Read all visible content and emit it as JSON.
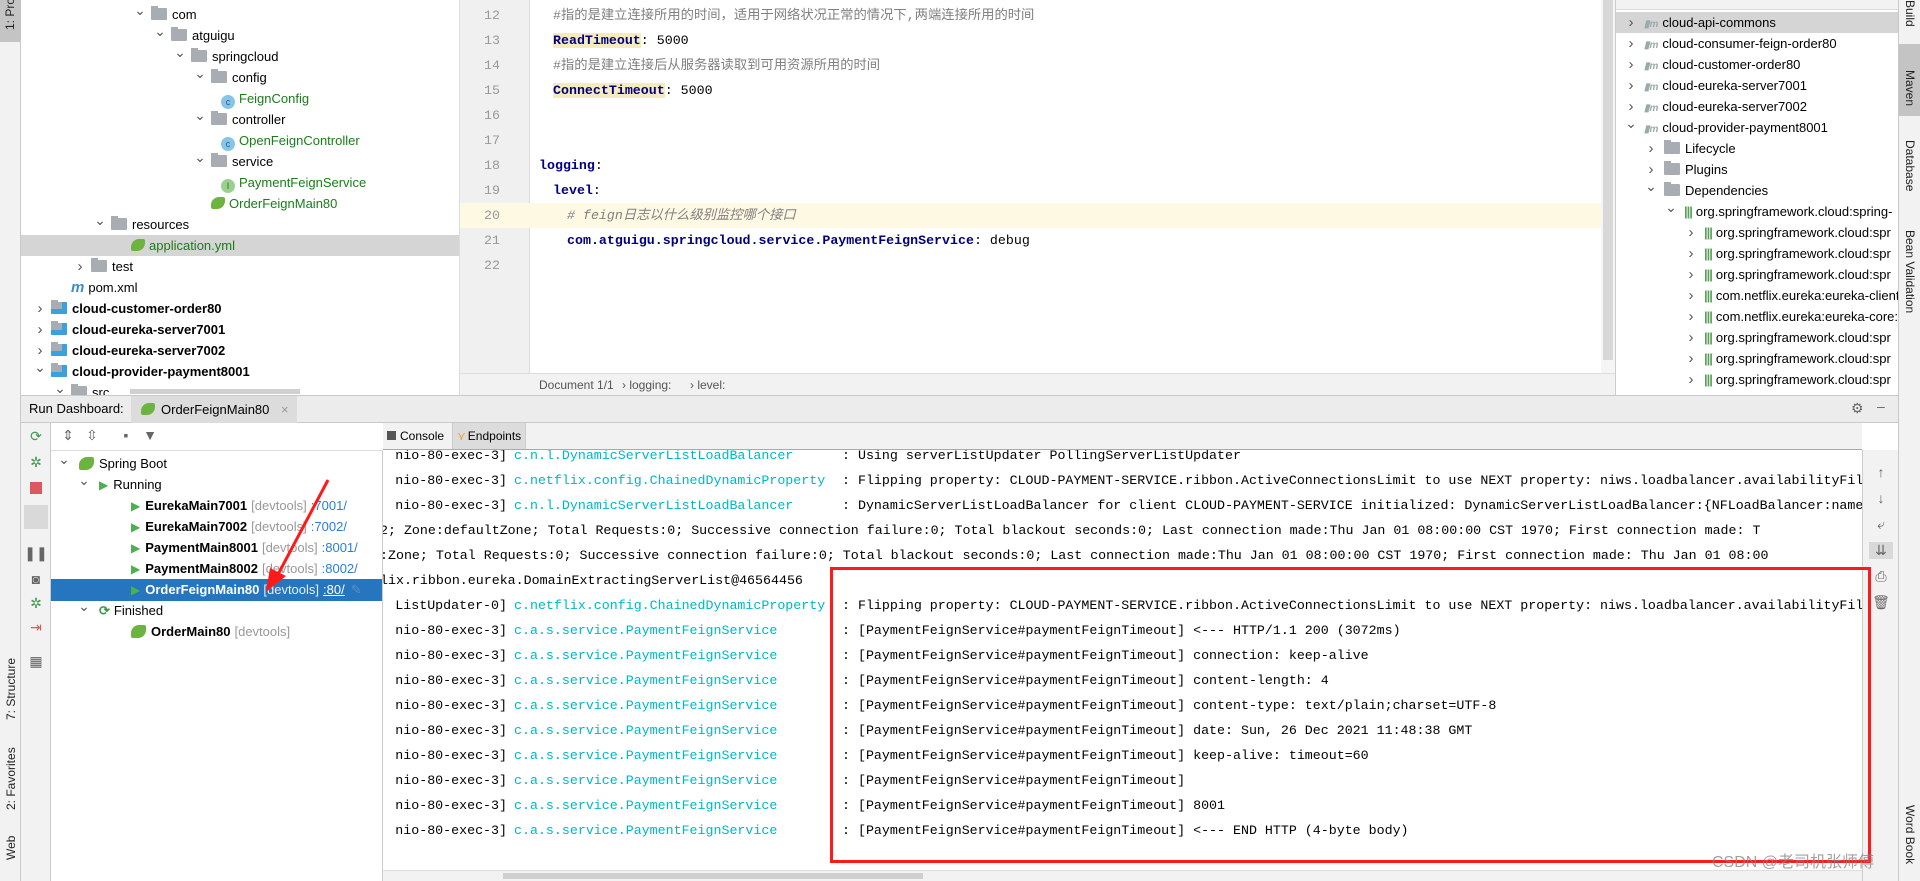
{
  "left_strip": {
    "project": "1: Project",
    "structure": "7: Structure",
    "favorites": "2: Favorites",
    "web": "Web"
  },
  "right_strip": {
    "build": "Build",
    "maven": "Maven",
    "database": "Database",
    "bean": "Bean Validation",
    "wordbook": "Word Book"
  },
  "project_tree": [
    {
      "label": "com",
      "type": "folder",
      "level": 5,
      "open": true
    },
    {
      "label": "atguigu",
      "type": "folder",
      "level": 6,
      "open": true
    },
    {
      "label": "springcloud",
      "type": "folder",
      "level": 7,
      "open": true
    },
    {
      "label": "config",
      "type": "folder",
      "level": 8,
      "open": true
    },
    {
      "label": "FeignConfig",
      "type": "class",
      "level": 9
    },
    {
      "label": "controller",
      "type": "folder",
      "level": 8,
      "open": true
    },
    {
      "label": "OpenFeignController",
      "type": "class",
      "level": 9
    },
    {
      "label": "service",
      "type": "folder",
      "level": 8,
      "open": true
    },
    {
      "label": "PaymentFeignService",
      "type": "interface",
      "level": 9
    },
    {
      "label": "OrderFeignMain80",
      "type": "boot",
      "level": 8
    },
    {
      "label": "resources",
      "type": "folder",
      "level": 3,
      "open": true
    },
    {
      "label": "application.yml",
      "type": "yml",
      "level": 4,
      "selected": true
    },
    {
      "label": "test",
      "type": "folder",
      "level": 2,
      "open": false
    },
    {
      "label": "pom.xml",
      "type": "pom",
      "level": 1
    },
    {
      "label": "cloud-customer-order80",
      "type": "module",
      "level": 0,
      "open": false
    },
    {
      "label": "cloud-eureka-server7001",
      "type": "module",
      "level": 0,
      "open": false
    },
    {
      "label": "cloud-eureka-server7002",
      "type": "module",
      "level": 0,
      "open": false
    },
    {
      "label": "cloud-provider-payment8001",
      "type": "module",
      "level": 0,
      "open": true
    },
    {
      "label": "src",
      "type": "folder",
      "level": 1,
      "open": true
    }
  ],
  "editor": {
    "lines": [
      {
        "n": "12",
        "indent": 1,
        "comment": "#指的是建立连接所用的时间，适用于网络状况正常的情况下,两端连接所用的时间"
      },
      {
        "n": "13",
        "indent": 1,
        "key": "ReadTimeout",
        "value": ": 5000",
        "hl": true
      },
      {
        "n": "14",
        "indent": 1,
        "comment": "#指的是建立连接后从服务器读取到可用资源所用的时间"
      },
      {
        "n": "15",
        "indent": 1,
        "key": "ConnectTimeout",
        "value": ": 5000",
        "hl": true
      },
      {
        "n": "16"
      },
      {
        "n": "17"
      },
      {
        "n": "18",
        "indent": 0,
        "key": "logging",
        "value": ":"
      },
      {
        "n": "19",
        "indent": 1,
        "key": "level",
        "value": ":"
      },
      {
        "n": "20",
        "indent": 2,
        "comment": "# feign日志以什么级别监控哪个接口",
        "current": true
      },
      {
        "n": "21",
        "indent": 2,
        "key": "com.atguigu.springcloud.service.PaymentFeignService",
        "value": ": debug"
      },
      {
        "n": "22"
      }
    ],
    "breadcrumb": [
      "Document 1/1",
      "logging:",
      "level:"
    ]
  },
  "maven": {
    "items": [
      {
        "label": "cloud-api-commons",
        "level": 0,
        "selected": true
      },
      {
        "label": "cloud-consumer-feign-order80",
        "level": 0
      },
      {
        "label": "cloud-customer-order80",
        "level": 0
      },
      {
        "label": "cloud-eureka-server7001",
        "level": 0
      },
      {
        "label": "cloud-eureka-server7002",
        "level": 0
      },
      {
        "label": "cloud-provider-payment8001",
        "level": 0,
        "open": true
      },
      {
        "label": "Lifecycle",
        "level": 1
      },
      {
        "label": "Plugins",
        "level": 1
      },
      {
        "label": "Dependencies",
        "level": 1,
        "open": true
      },
      {
        "label": "org.springframework.cloud:spring-",
        "level": 2,
        "open": true
      },
      {
        "label": "org.springframework.cloud:spr",
        "level": 3
      },
      {
        "label": "org.springframework.cloud:spr",
        "level": 3
      },
      {
        "label": "org.springframework.cloud:spr",
        "level": 3
      },
      {
        "label": "com.netflix.eureka:eureka-client",
        "level": 3
      },
      {
        "label": "com.netflix.eureka:eureka-core:",
        "level": 3
      },
      {
        "label": "org.springframework.cloud:spr",
        "level": 3
      },
      {
        "label": "org.springframework.cloud:spr",
        "level": 3
      },
      {
        "label": "org.springframework.cloud:spr",
        "level": 3
      }
    ]
  },
  "run_dashboard": {
    "title": "Run Dashboard:",
    "tab": "OrderFeignMain80",
    "tree": [
      {
        "label": "Spring Boot",
        "level": 0,
        "type": "group"
      },
      {
        "label": "Running",
        "level": 1,
        "type": "running"
      },
      {
        "label": "EurekaMain7001",
        "tag": "[devtools]",
        "port": ":7001/",
        "level": 2,
        "type": "app"
      },
      {
        "label": "EurekaMain7002",
        "tag": "[devtools]",
        "port": ":7002/",
        "level": 2,
        "type": "app"
      },
      {
        "label": "PaymentMain8001",
        "tag": "[devtools]",
        "port": ":8001/",
        "level": 2,
        "type": "app"
      },
      {
        "label": "PaymentMain8002",
        "tag": "[devtools]",
        "port": ":8002/",
        "level": 2,
        "type": "app"
      },
      {
        "label": "OrderFeignMain80",
        "tag": "[devtools]",
        "port": ":80/",
        "level": 2,
        "type": "app",
        "selected": true
      },
      {
        "label": "Finished",
        "level": 1,
        "type": "finished"
      },
      {
        "label": "OrderMain80",
        "tag": "[devtools]",
        "level": 2,
        "type": "finishedapp"
      }
    ],
    "console_tabs": [
      "Console",
      "Endpoints"
    ],
    "console_lines": [
      {
        "thread": "nio-80-exec-3]",
        "logger": "c.n.l.DynamicServerListLoadBalancer",
        "msg": ": Using serverListUpdater PollingServerListUpdater"
      },
      {
        "thread": "nio-80-exec-3]",
        "logger": "c.netflix.config.ChainedDynamicProperty",
        "msg": ": Flipping property: CLOUD-PAYMENT-SERVICE.ribbon.ActiveConnectionsLimit to use NEXT property: niws.loadbalancer.availabilityFil"
      },
      {
        "thread": "nio-80-exec-3]",
        "logger": "c.n.l.DynamicServerListLoadBalancer",
        "msg": ": DynamicServerListLoadBalancer for client CLOUD-PAYMENT-SERVICE initialized: DynamicServerListLoadBalancer:{NFLoadBalancer:name="
      },
      {
        "plain": "2;   Zone:defaultZone;   Total Requests:0;   Successive connection failure:0;   Total blackout seconds:0;   Last connection made:Thu Jan 01 08:00:00 CST 1970;   First connection made: T"
      },
      {
        "plain": ":Zone;   Total Requests:0;   Successive connection failure:0;   Total blackout seconds:0;   Last connection made:Thu Jan 01 08:00:00 CST 1970;   First connection made: Thu Jan 01 08:00"
      },
      {
        "plain": "lix.ribbon.eureka.DomainExtractingServerList@46564456"
      },
      {
        "thread": "ListUpdater-0]",
        "logger": "c.netflix.config.ChainedDynamicProperty",
        "msg": ": Flipping property: CLOUD-PAYMENT-SERVICE.ribbon.ActiveConnectionsLimit to use NEXT property: niws.loadbalancer.availabilityFil"
      },
      {
        "thread": "nio-80-exec-3]",
        "logger": "c.a.s.service.PaymentFeignService",
        "msg": ": [PaymentFeignService#paymentFeignTimeout] <--- HTTP/1.1 200 (3072ms)"
      },
      {
        "thread": "nio-80-exec-3]",
        "logger": "c.a.s.service.PaymentFeignService",
        "msg": ": [PaymentFeignService#paymentFeignTimeout] connection: keep-alive"
      },
      {
        "thread": "nio-80-exec-3]",
        "logger": "c.a.s.service.PaymentFeignService",
        "msg": ": [PaymentFeignService#paymentFeignTimeout] content-length: 4"
      },
      {
        "thread": "nio-80-exec-3]",
        "logger": "c.a.s.service.PaymentFeignService",
        "msg": ": [PaymentFeignService#paymentFeignTimeout] content-type: text/plain;charset=UTF-8"
      },
      {
        "thread": "nio-80-exec-3]",
        "logger": "c.a.s.service.PaymentFeignService",
        "msg": ": [PaymentFeignService#paymentFeignTimeout] date: Sun, 26 Dec 2021 11:48:38 GMT"
      },
      {
        "thread": "nio-80-exec-3]",
        "logger": "c.a.s.service.PaymentFeignService",
        "msg": ": [PaymentFeignService#paymentFeignTimeout] keep-alive: timeout=60"
      },
      {
        "thread": "nio-80-exec-3]",
        "logger": "c.a.s.service.PaymentFeignService",
        "msg": ": [PaymentFeignService#paymentFeignTimeout]"
      },
      {
        "thread": "nio-80-exec-3]",
        "logger": "c.a.s.service.PaymentFeignService",
        "msg": ": [PaymentFeignService#paymentFeignTimeout] 8001"
      },
      {
        "thread": "nio-80-exec-3]",
        "logger": "c.a.s.service.PaymentFeignService",
        "msg": ": [PaymentFeignService#paymentFeignTimeout] <--- END HTTP (4-byte body)"
      }
    ]
  },
  "watermark": "CSDN @老司机张师傅",
  "colors": {
    "selection": "#2675bf",
    "logger": "#00b7c3",
    "annotation": "#ff1a1a",
    "run_green": "#4caf50"
  }
}
